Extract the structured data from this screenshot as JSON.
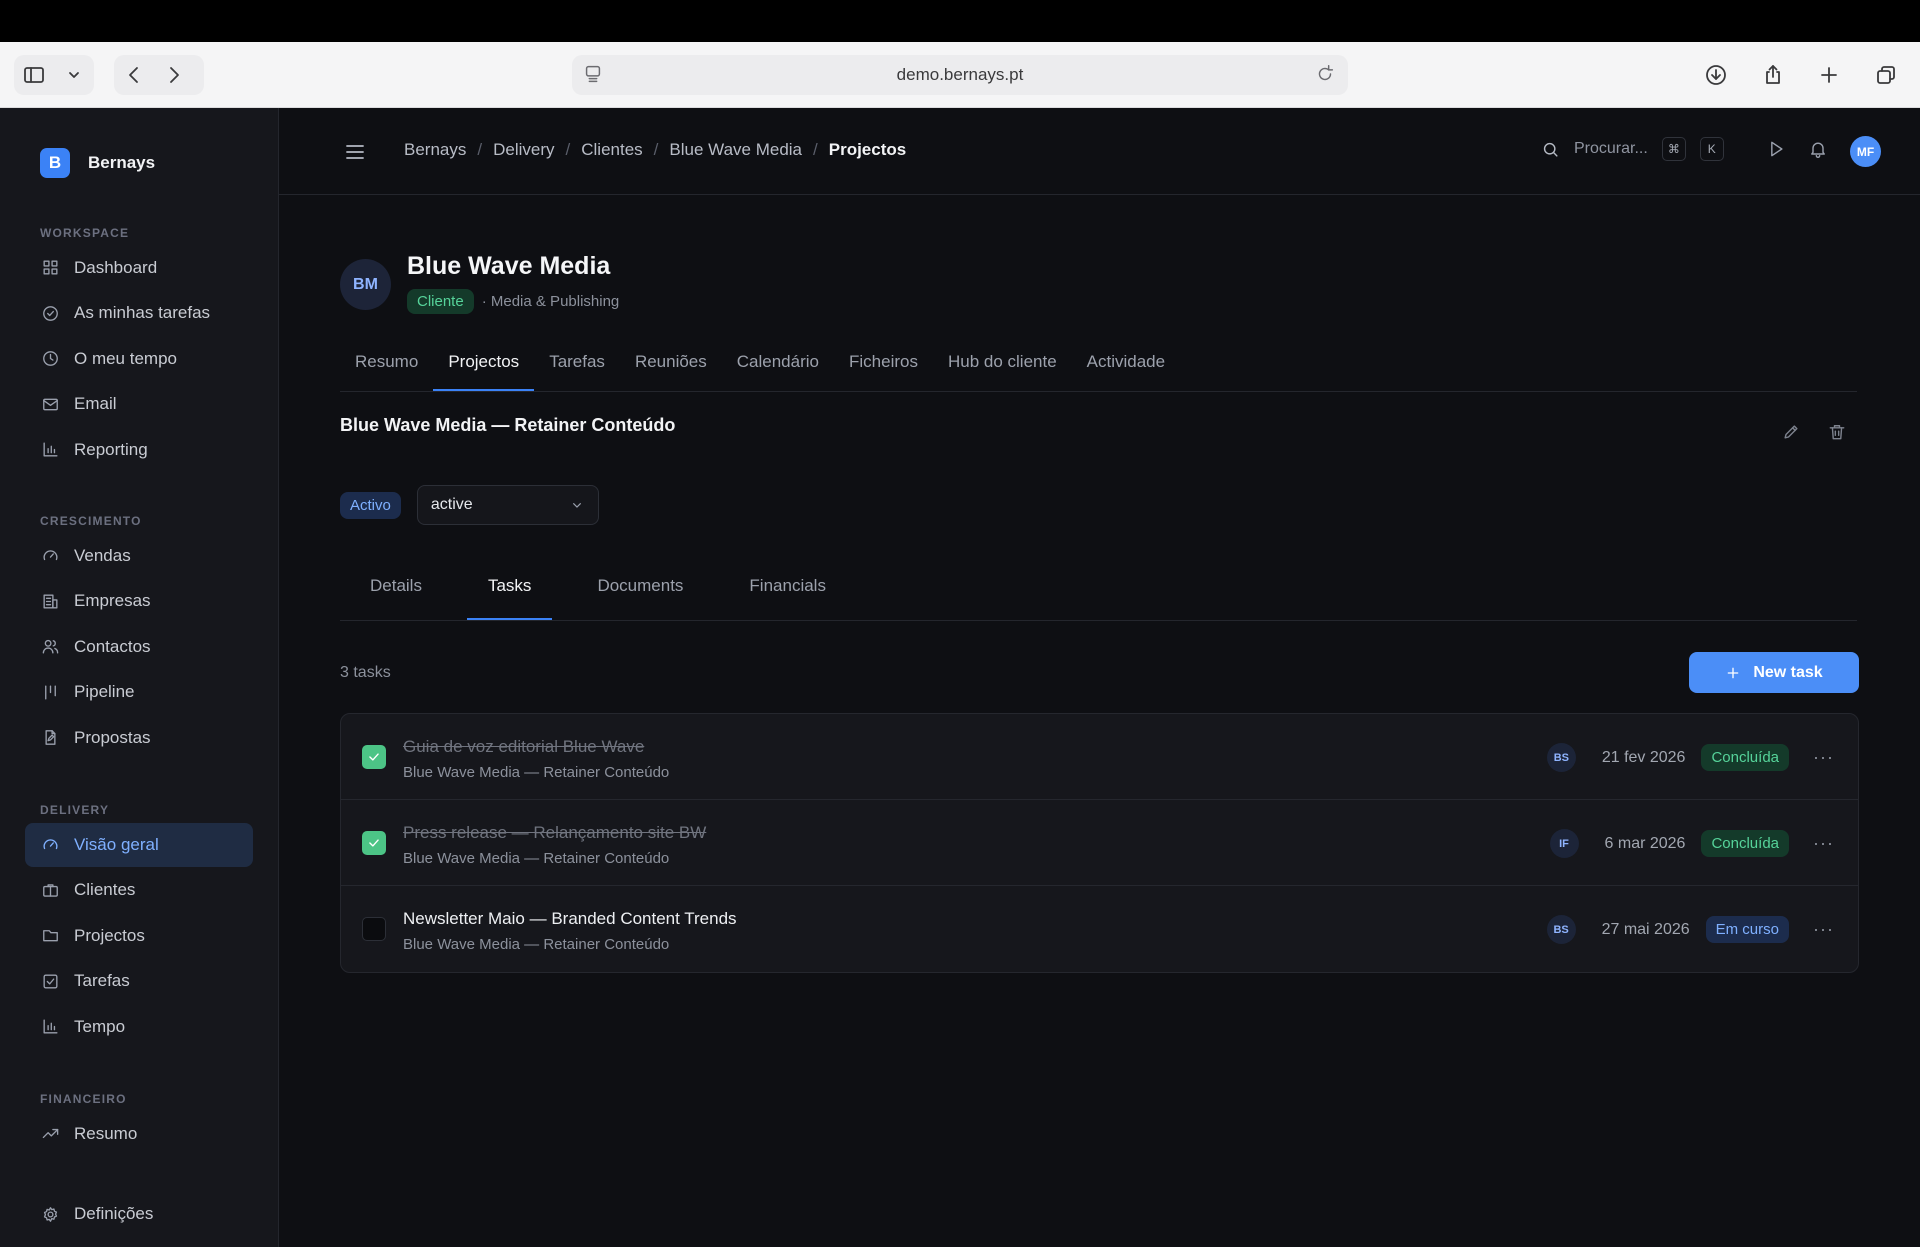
{
  "browser": {
    "url": "demo.bernays.pt"
  },
  "sidebar": {
    "brand_initial": "B",
    "brand_name": "Bernays",
    "sections": {
      "workspace": {
        "heading": "WORKSPACE",
        "items": [
          "Dashboard",
          "As minhas tarefas",
          "O meu tempo",
          "Email",
          "Reporting"
        ]
      },
      "growth": {
        "heading": "CRESCIMENTO",
        "items": [
          "Vendas",
          "Empresas",
          "Contactos",
          "Pipeline",
          "Propostas"
        ]
      },
      "delivery": {
        "heading": "DELIVERY",
        "items": [
          "Visão geral",
          "Clientes",
          "Projectos",
          "Tarefas",
          "Tempo"
        ],
        "active_item": "Visão geral"
      },
      "finance": {
        "heading": "FINANCEIRO",
        "items": [
          "Resumo"
        ]
      }
    },
    "settings_label": "Definições"
  },
  "topnav": {
    "breadcrumb": [
      "Bernays",
      "Delivery",
      "Clientes",
      "Blue Wave Media",
      "Projectos"
    ],
    "search_label": "Procurar...",
    "shortcut_keys": [
      "⌘",
      "K"
    ],
    "user_initials": "MF"
  },
  "client": {
    "initials": "BM",
    "name": "Blue Wave Media",
    "type_badge": "Cliente",
    "industry": "· Media & Publishing",
    "tabs": [
      "Resumo",
      "Projectos",
      "Tarefas",
      "Reuniões",
      "Calendário",
      "Ficheiros",
      "Hub do cliente",
      "Actividade"
    ],
    "active_tab": "Projectos"
  },
  "project": {
    "title": "Blue Wave Media — Retainer Conteúdo",
    "status_badge": "Activo",
    "status_select_value": "active",
    "tabs": [
      "Details",
      "Tasks",
      "Documents",
      "Financials"
    ],
    "active_tab": "Tasks",
    "task_count_label": "3 tasks",
    "new_task_label": "New task",
    "tasks": [
      {
        "title": "Guia de voz editorial Blue Wave",
        "project": "Blue Wave Media — Retainer Conteúdo",
        "assignee": "BS",
        "due": "21 fev 2026",
        "status": "Concluída",
        "done": true
      },
      {
        "title": "Press release — Relançamento site BW",
        "project": "Blue Wave Media — Retainer Conteúdo",
        "assignee": "IF",
        "due": "6 mar 2026",
        "status": "Concluída",
        "done": true
      },
      {
        "title": "Newsletter Maio — Branded Content Trends",
        "project": "Blue Wave Media — Retainer Conteúdo",
        "assignee": "BS",
        "due": "27 mai 2026",
        "status": "Em curso",
        "done": false
      }
    ],
    "more_label": "···"
  },
  "colors": {
    "accent": "#4b8ef7",
    "success": "#56d39a",
    "background": "#0e0f13",
    "sidebar": "#16171c"
  }
}
